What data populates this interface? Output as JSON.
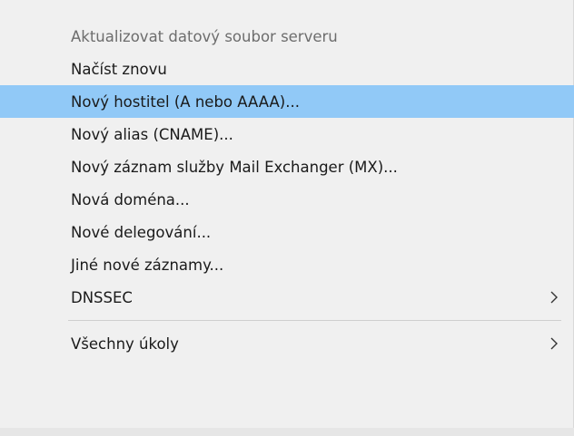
{
  "menu": {
    "items": [
      {
        "label": "Aktualizovat datový soubor serveru",
        "disabled": true
      },
      {
        "label": "Načíst znovu"
      },
      {
        "label": "Nový hostitel (A nebo AAAA)...",
        "highlighted": true
      },
      {
        "label": "Nový alias (CNAME)..."
      },
      {
        "label": "Nový záznam služby Mail Exchanger (MX)..."
      },
      {
        "label": "Nová doména..."
      },
      {
        "label": "Nové delegování..."
      },
      {
        "label": "Jiné nové záznamy..."
      },
      {
        "label": "DNSSEC",
        "submenu": true
      }
    ],
    "items2": [
      {
        "label": "Všechny úkoly",
        "submenu": true
      }
    ]
  },
  "colors": {
    "background": "#f0f0f0",
    "highlight": "#91c9f7",
    "text": "#1a1a1a",
    "disabled_text": "#6d6d6d"
  }
}
